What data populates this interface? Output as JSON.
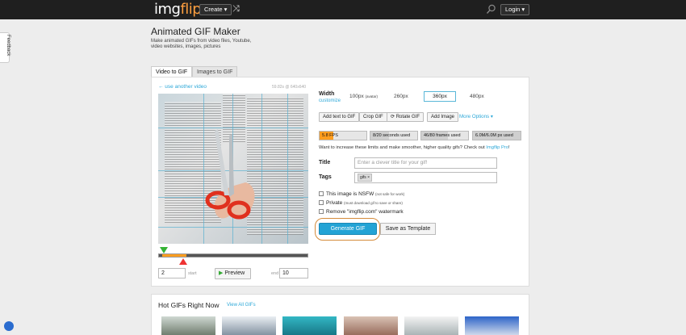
{
  "header": {
    "logo_img": "img",
    "logo_flip": "flip",
    "create_label": "Create ▾",
    "shuffle_icon": "shuffle-icon",
    "login_label": "Login ▾"
  },
  "feedback_label": "Feedback",
  "page": {
    "title": "Animated GIF Maker",
    "description": "Make animated GIFs from video files, Youtube, video websites, images, pictures"
  },
  "tabs": [
    {
      "label": "Video to GIF",
      "active": true
    },
    {
      "label": "Images to GIF",
      "active": false
    }
  ],
  "video": {
    "use_another": "← use another video",
    "meta": "59.82s @ 640x640",
    "start_value": "2",
    "start_label": "start",
    "preview_label": "Preview",
    "end_label": "end",
    "end_value": "10"
  },
  "options": {
    "width_label": "Width",
    "customize": "customize",
    "widths": [
      {
        "label": "100px",
        "note": "(avatar)",
        "selected": false
      },
      {
        "label": "260px",
        "selected": false
      },
      {
        "label": "360px",
        "selected": true
      },
      {
        "label": "480px",
        "selected": false
      }
    ],
    "tools": {
      "add_text": "Add text to GIF",
      "crop": "Crop GIF",
      "rotate": "Rotate GIF",
      "add_image": "Add Image",
      "more": "More Options ▾"
    },
    "stats": [
      {
        "label": "5.8 FPS",
        "fill": 0.3,
        "color": "#ff9d1e"
      },
      {
        "label": "8/20 seconds used",
        "fill": 0.4,
        "color": "#cfcfcf"
      },
      {
        "label": "46/80 frames used",
        "fill": 0.575,
        "color": "#cfcfcf"
      },
      {
        "label": "6.0M/6.0M px used",
        "fill": 1.0,
        "color": "#cfcfcf"
      }
    ],
    "upgrade_text": "Want to increase these limits and make smoother, higher quality gifs? Check out ",
    "upgrade_link": "Imgflip Pro",
    "upgrade_end": "!",
    "title_label": "Title",
    "title_placeholder": "Enter a clever title for your gif!",
    "tags_label": "Tags",
    "tag_chip": "gifs ×",
    "nsfw_label": "This image is NSFW",
    "nsfw_sub": "(not safe for work)",
    "private_label": "Private",
    "private_sub": "(must download gif to save or share)",
    "watermark_label": "Remove \"imgflip.com\" watermark",
    "generate_label": "Generate GIF",
    "save_template_label": "Save as Template"
  },
  "hot": {
    "title": "Hot GIFs Right Now",
    "view_all": "View All GIFs"
  }
}
